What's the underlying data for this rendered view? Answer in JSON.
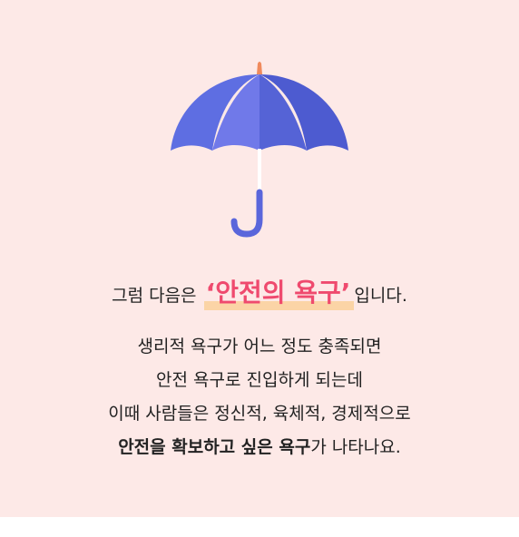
{
  "headline": {
    "prefix": "그럼 다음은 ",
    "highlight": "‘안전의 욕구’",
    "suffix": "입니다."
  },
  "body": {
    "line1": "생리적 욕구가 어느 정도 충족되면",
    "line2": "안전 욕구로 진입하게 되는데",
    "line3": "이때 사람들은 정신적, 육체적, 경제적으로",
    "line4_bold": "안전을 확보하고 싶은 욕구",
    "line4_rest": "가 나타나요."
  },
  "colors": {
    "background": "#fde9e7",
    "highlight_text": "#ef4a6e",
    "highlight_underline": "#fbd4a6",
    "umbrella_main": "#5c6be0",
    "umbrella_tip": "#f08a5d"
  },
  "icons": {
    "umbrella": "umbrella-icon"
  }
}
